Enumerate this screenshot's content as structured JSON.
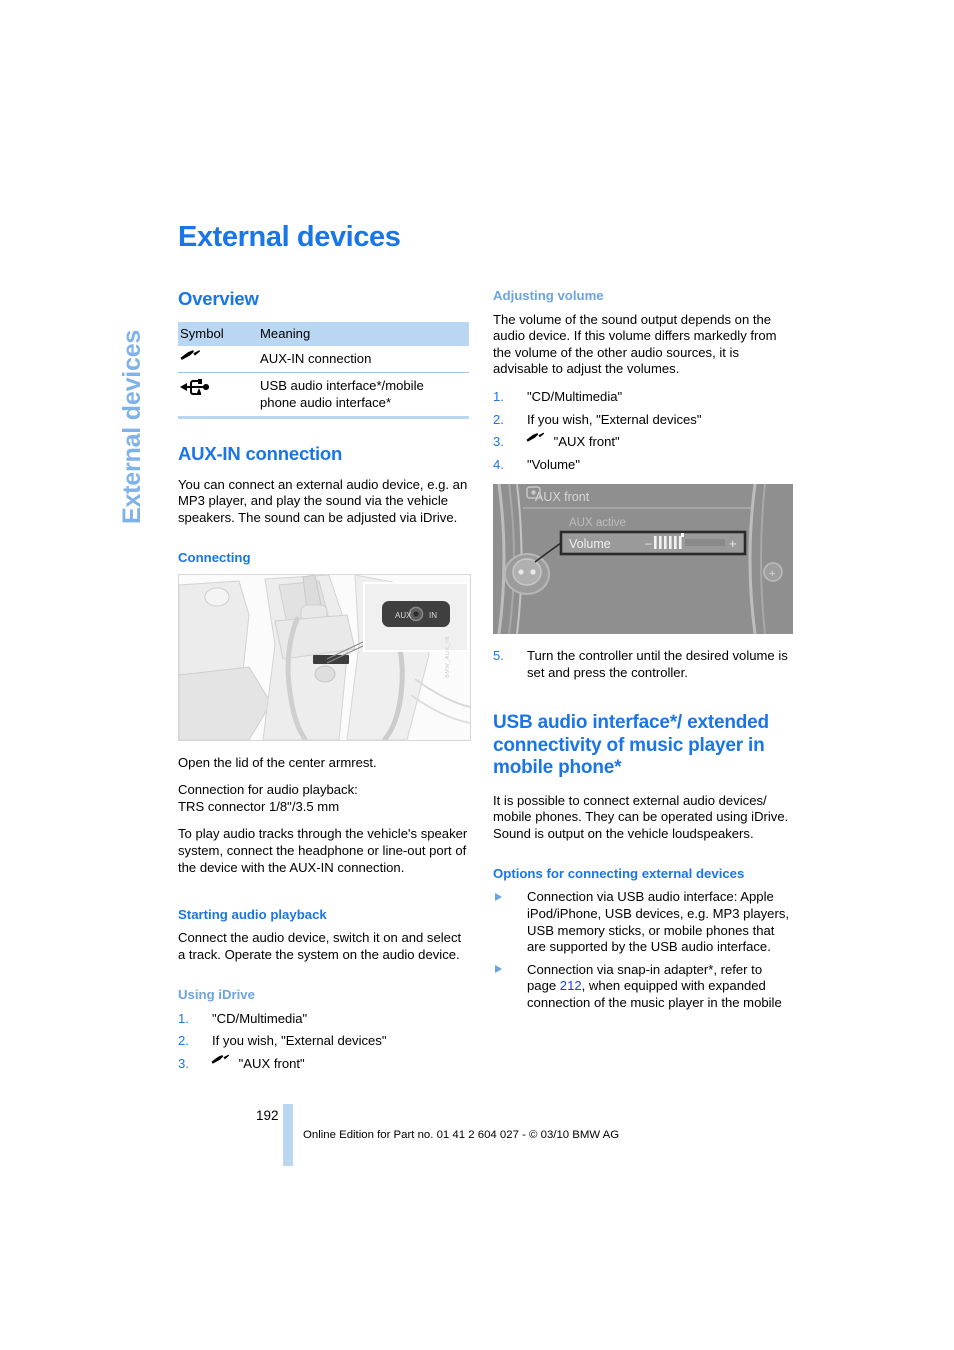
{
  "colors": {
    "heading_blue": "#1a76e8",
    "subheading_blue": "#1a76e8",
    "light_blue": "#6ba4de",
    "tab_blue": "#7fb2e8",
    "table_header_bg": "#b9d6f2",
    "page_ref_blue": "#1a3fe8"
  },
  "side_tab": {
    "label": "External devices"
  },
  "page_title": "External devices",
  "left_column": {
    "overview": {
      "heading": "Overview",
      "table": {
        "headers": [
          "Symbol",
          "Meaning"
        ],
        "rows": [
          {
            "symbol_icon": "aux-jack-icon",
            "meaning": "AUX-IN connection"
          },
          {
            "symbol_icon": "usb-trident-icon",
            "meaning": "USB audio interface*/mobile phone audio interface*"
          }
        ]
      }
    },
    "aux_in": {
      "heading": "AUX-IN connection",
      "intro": "You can connect an external audio device, e.g. an MP3 player, and play the sound via the vehicle speakers. The sound can be adjusted via iDrive.",
      "connecting": {
        "heading": "Connecting",
        "figure": {
          "name": "armrest-aux-port-illustration",
          "callout_label": "AUX IN",
          "code": "BMW_AUX_IN"
        },
        "paragraphs": [
          "Open the lid of the center armrest.",
          "Connection for audio playback:\nTRS connector 1/8\"/3.5 mm",
          "To play audio tracks through the vehicle's speaker system, connect the headphone or line-out port of the device with the AUX-IN connection."
        ],
        "para_1": "Open the lid of the center armrest.",
        "para_2_line1": "Connection for audio playback:",
        "para_2_line2": "TRS connector 1/8\"/3.5 mm",
        "para_3": "To play audio tracks through the vehicle's speaker system, connect the headphone or line-out port of the device with the AUX-IN connection."
      },
      "starting_playback": {
        "heading": "Starting audio playback",
        "text": "Connect the audio device, switch it on and select a track. Operate the system on the audio device."
      },
      "using_idrive": {
        "heading": "Using iDrive",
        "steps": [
          {
            "num": "1.",
            "text": "\"CD/Multimedia\"",
            "icon": null
          },
          {
            "num": "2.",
            "text": "If you wish, \"External devices\"",
            "icon": null
          },
          {
            "num": "3.",
            "text": "\"AUX front\"",
            "icon": "aux-jack-icon"
          }
        ]
      }
    }
  },
  "right_column": {
    "adjusting_volume": {
      "heading": "Adjusting volume",
      "intro": "The volume of the sound output depends on the audio device. If this volume differs markedly from the volume of the other audio sources, it is advisable to adjust the volumes.",
      "steps": [
        {
          "num": "1.",
          "text": "\"CD/Multimedia\"",
          "icon": null
        },
        {
          "num": "2.",
          "text": "If you wish, \"External devices\"",
          "icon": null
        },
        {
          "num": "3.",
          "text": "\"AUX front\"",
          "icon": "aux-jack-icon"
        },
        {
          "num": "4.",
          "text": "\"Volume\"",
          "icon": null
        }
      ],
      "figure": {
        "name": "idrive-aux-front-volume-screen",
        "title": "AUX front",
        "status": "AUX active",
        "row_label": "Volume",
        "minus": "–",
        "plus": "+"
      },
      "step5": {
        "num": "5.",
        "text": "Turn the controller until the desired volume is set and press the controller."
      }
    },
    "usb_section": {
      "heading": "USB audio interface*/ extended connectivity of music player in mobile phone*",
      "intro": "It is possible to connect external audio devices/ mobile phones. They can be operated using iDrive. Sound is output on the vehicle loudspeakers.",
      "options": {
        "heading": "Options for connecting external devices",
        "items": [
          {
            "text_before": "Connection via USB audio interface: Apple iPod/iPhone, USB devices, e.g. MP3 players, USB memory sticks, or mobile phones that are supported by the USB audio interface.",
            "page_ref": null,
            "text_after": null
          },
          {
            "text_before": "Connection via snap-in adapter*, refer to page ",
            "page_ref": "212",
            "text_after": ", when equipped with expanded connection of the music player in the mobile"
          }
        ]
      }
    }
  },
  "footer": {
    "page_number": "192",
    "edition_line": "Online Edition for Part no. 01 41 2 604 027 - © 03/10 BMW AG"
  }
}
